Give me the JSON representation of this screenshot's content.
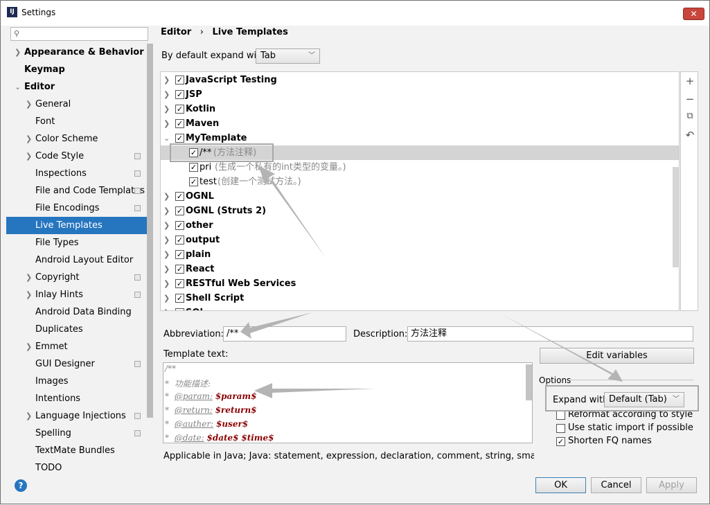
{
  "window": {
    "title": "Settings",
    "app_icon": "IJ"
  },
  "search": {
    "placeholder": ""
  },
  "sidebar": {
    "items": [
      {
        "label": "Appearance & Behavior"
      },
      {
        "label": "Keymap"
      },
      {
        "label": "Editor"
      },
      {
        "label": "General"
      },
      {
        "label": "Font"
      },
      {
        "label": "Color Scheme"
      },
      {
        "label": "Code Style"
      },
      {
        "label": "Inspections"
      },
      {
        "label": "File and Code Templates"
      },
      {
        "label": "File Encodings"
      },
      {
        "label": "Live Templates"
      },
      {
        "label": "File Types"
      },
      {
        "label": "Android Layout Editor"
      },
      {
        "label": "Copyright"
      },
      {
        "label": "Inlay Hints"
      },
      {
        "label": "Android Data Binding"
      },
      {
        "label": "Duplicates"
      },
      {
        "label": "Emmet"
      },
      {
        "label": "GUI Designer"
      },
      {
        "label": "Images"
      },
      {
        "label": "Intentions"
      },
      {
        "label": "Language Injections"
      },
      {
        "label": "Spelling"
      },
      {
        "label": "TextMate Bundles"
      },
      {
        "label": "TODO"
      }
    ]
  },
  "breadcrumb": {
    "parent": "Editor",
    "separator": "›",
    "current": "Live Templates"
  },
  "expand_default": {
    "label": "By default expand with",
    "value": "Tab"
  },
  "tree": {
    "rows": [
      {
        "label": "JavaScript Testing",
        "desc": ""
      },
      {
        "label": "JSP",
        "desc": ""
      },
      {
        "label": "Kotlin",
        "desc": ""
      },
      {
        "label": "Maven",
        "desc": ""
      },
      {
        "label": "MyTemplate",
        "desc": ""
      },
      {
        "label": "/**",
        "desc": "(方法注释)"
      },
      {
        "label": "pri",
        "desc": "(生成一个私有的int类型的变量。)"
      },
      {
        "label": "test",
        "desc": "(创建一个测试方法。)"
      },
      {
        "label": "OGNL",
        "desc": ""
      },
      {
        "label": "OGNL (Struts 2)",
        "desc": ""
      },
      {
        "label": "other",
        "desc": ""
      },
      {
        "label": "output",
        "desc": ""
      },
      {
        "label": "plain",
        "desc": ""
      },
      {
        "label": "React",
        "desc": ""
      },
      {
        "label": "RESTful Web Services",
        "desc": ""
      },
      {
        "label": "Shell Script",
        "desc": ""
      },
      {
        "label": "SQL",
        "desc": ""
      }
    ],
    "toolbar": {
      "add": "+",
      "remove": "−",
      "copy": "⧉",
      "restore": "↶"
    }
  },
  "abbreviation": {
    "label": "Abbreviation:",
    "value": "/**"
  },
  "description": {
    "label": "Description:",
    "value": "方法注释"
  },
  "template_text": {
    "label": "Template text:",
    "lines": {
      "l0": "/**",
      "l1_star": "* ",
      "l1_text": "功能描述:",
      "l2_star": "* ",
      "l2_tag": "@param:",
      "l2_var": "$param$",
      "l3_star": "* ",
      "l3_tag": "@return:",
      "l3_var": "$return$",
      "l4_star": "* ",
      "l4_tag": "@auther:",
      "l4_var": "$user$",
      "l5_star": "* ",
      "l5_tag": "@date:",
      "l5_var": "$date$",
      "l5_var2": "$time$"
    }
  },
  "edit_variables": "Edit variables",
  "options": {
    "title": "Options",
    "expand_with_label": "Expand with",
    "expand_with_value": "Default (Tab)",
    "checks": [
      {
        "label": "Reformat according to style",
        "checked": false
      },
      {
        "label": "Use static import if possible",
        "checked": false
      },
      {
        "label": "Shorten FQ names",
        "checked": true
      }
    ]
  },
  "applicable": "Applicable in Java; Java: statement, expression, declaration, comment, string, smart type cor",
  "buttons": {
    "ok": "OK",
    "cancel": "Cancel",
    "apply": "Apply",
    "help": "?",
    "close": "✕"
  }
}
